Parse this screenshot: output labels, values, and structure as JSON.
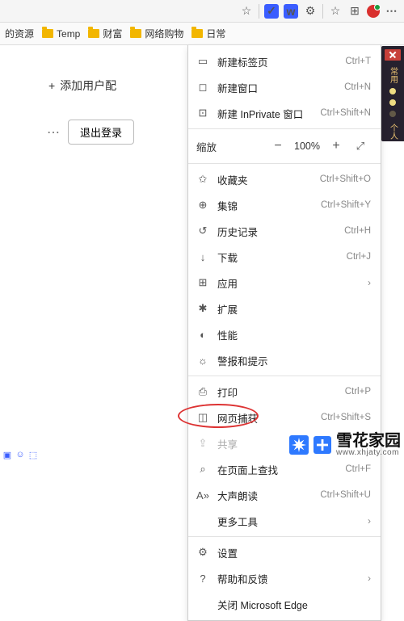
{
  "toolbar": {
    "star": "☆",
    "ext1": "✓",
    "ext2": "w",
    "gear": "⚙",
    "separator": "|",
    "favstar": "☆",
    "collections": "⊞",
    "more": "⋯"
  },
  "bookmarks": {
    "items": [
      {
        "label": "的资源"
      },
      {
        "label": "Temp"
      },
      {
        "label": "财富"
      },
      {
        "label": "网络购物"
      },
      {
        "label": "日常"
      }
    ]
  },
  "page": {
    "add_profile": "添加用户配",
    "plus": "+",
    "dots": "⋯",
    "logout": "退出登录"
  },
  "ext_panel": {
    "text": "常用",
    "label2": "个人"
  },
  "menu": {
    "new_tab": "新建标签页",
    "new_tab_sc": "Ctrl+T",
    "new_window": "新建窗口",
    "new_window_sc": "Ctrl+N",
    "new_inprivate": "新建 InPrivate 窗口",
    "new_inprivate_sc": "Ctrl+Shift+N",
    "zoom_label": "缩放",
    "zoom_minus": "−",
    "zoom_value": "100%",
    "zoom_plus": "+",
    "zoom_full": "⤢",
    "favorites": "收藏夹",
    "favorites_sc": "Ctrl+Shift+O",
    "collections": "集锦",
    "collections_sc": "Ctrl+Shift+Y",
    "history": "历史记录",
    "history_sc": "Ctrl+H",
    "downloads": "下载",
    "downloads_sc": "Ctrl+J",
    "apps": "应用",
    "extensions": "扩展",
    "performance": "性能",
    "alerts": "警报和提示",
    "print": "打印",
    "print_sc": "Ctrl+P",
    "capture": "网页捕获",
    "capture_sc": "Ctrl+Shift+S",
    "share": "共享",
    "find": "在页面上查找",
    "find_sc": "Ctrl+F",
    "read_aloud": "大声朗读",
    "read_aloud_sc": "Ctrl+Shift+U",
    "more_tools": "更多工具",
    "settings": "设置",
    "help": "帮助和反馈",
    "close_edge": "关闭 Microsoft Edge"
  },
  "watermark": {
    "main": "雪花家园",
    "sub": "www.xhjaty.com"
  }
}
